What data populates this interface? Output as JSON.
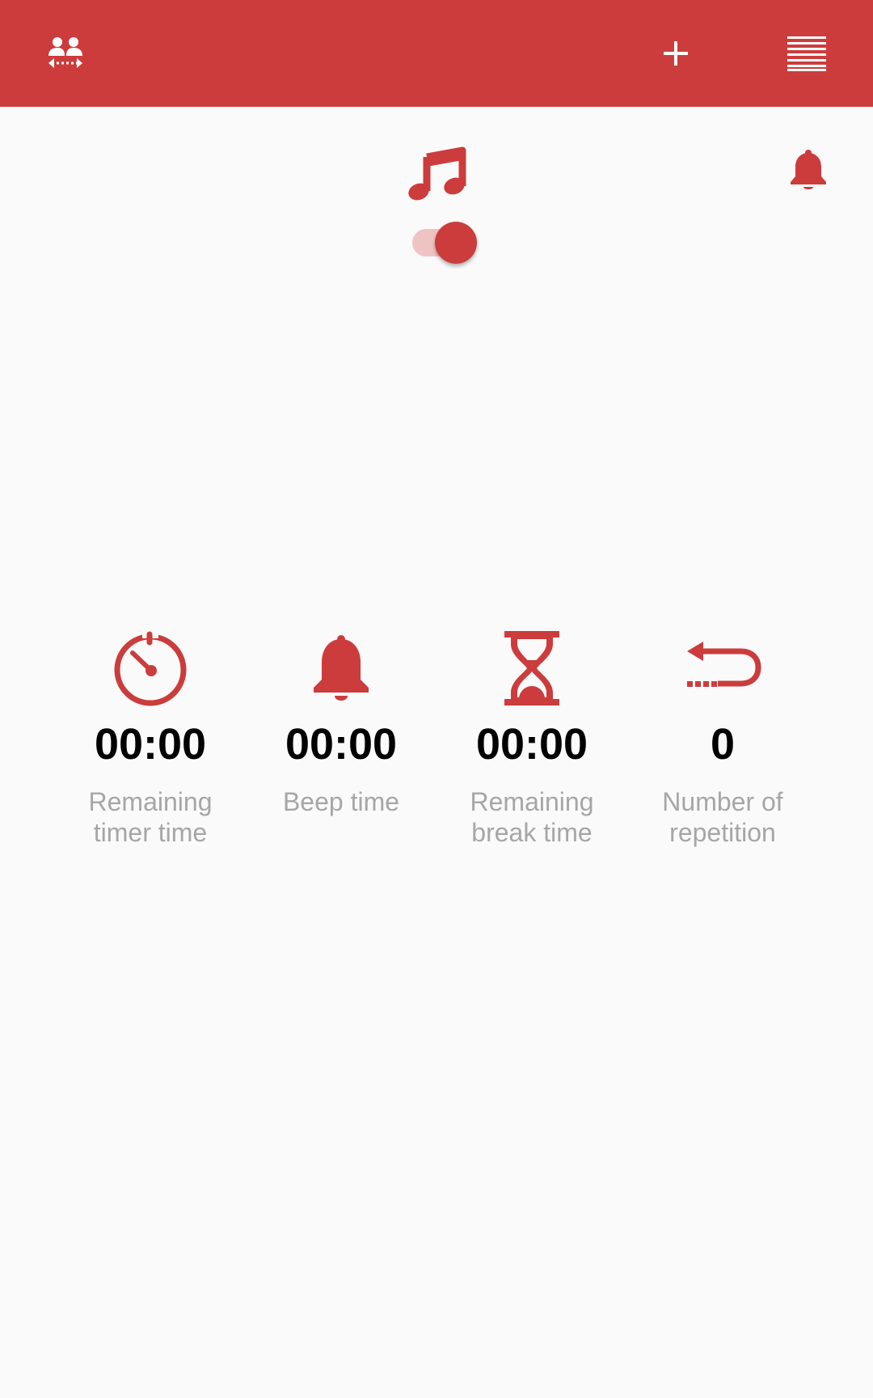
{
  "app_bar": {
    "background": "#cc3c3c",
    "left_icon": "people-swap-icon",
    "add_icon": "plus-icon",
    "menu_icon": "list-menu-icon"
  },
  "controls": {
    "music_icon": "music-note-icon",
    "bell_icon": "bell-icon",
    "music_toggle_on": true
  },
  "stats": [
    {
      "icon": "stopwatch-icon",
      "value": "00:00",
      "label": "Remaining timer time"
    },
    {
      "icon": "bell-icon",
      "value": "00:00",
      "label": "Beep time"
    },
    {
      "icon": "hourglass-icon",
      "value": "00:00",
      "label": "Remaining break time"
    },
    {
      "icon": "repeat-arrow-icon",
      "value": "0",
      "label": "Number of repetition"
    }
  ],
  "colors": {
    "accent": "#cc3c3c",
    "accent_light": "#f0c3c3",
    "label_gray": "#a6a6a6",
    "background": "#fafafa"
  }
}
